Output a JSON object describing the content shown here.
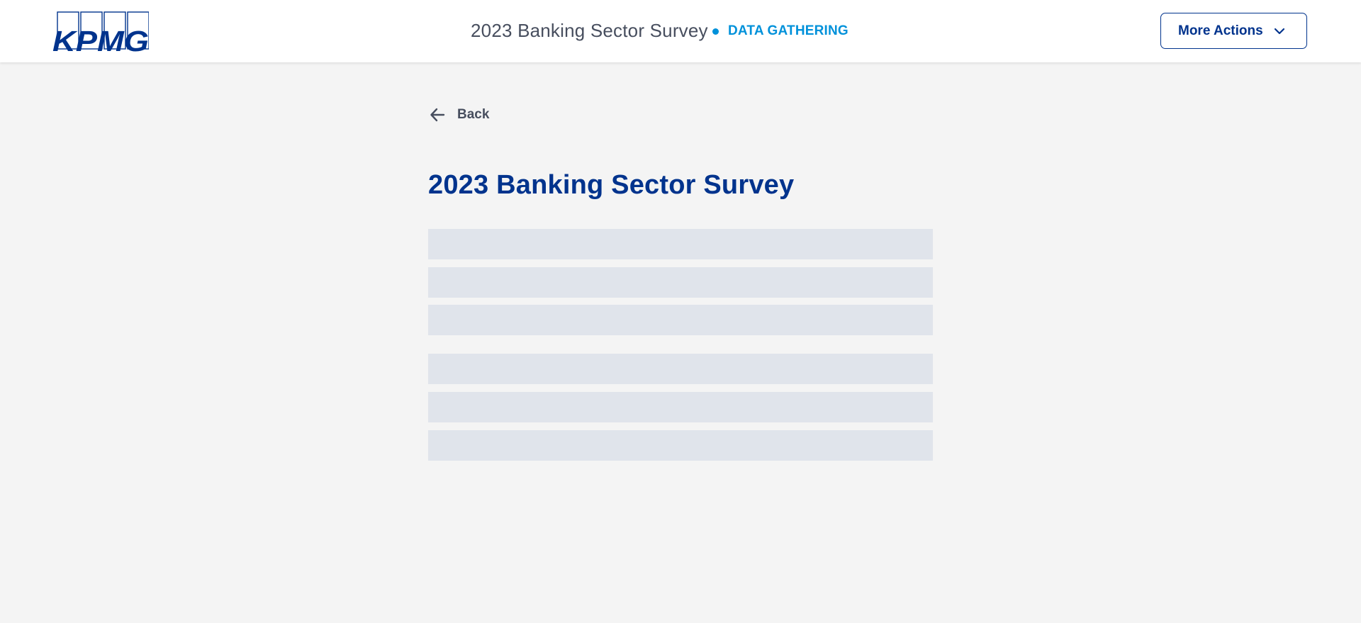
{
  "header": {
    "logo_text": "KPMG",
    "survey_title": "2023 Banking Sector Survey",
    "status": "DATA GATHERING",
    "more_actions_label": "More Actions"
  },
  "nav": {
    "back_label": "Back"
  },
  "main": {
    "title": "2023 Banking Sector Survey",
    "loading_placeholders": 6
  },
  "colors": {
    "brand_blue": "#00338d",
    "status_blue": "#0091da",
    "background": "#f4f4f4",
    "skeleton": "#e0e4eb"
  },
  "icons": {
    "back": "arrow-left-icon",
    "dropdown": "chevron-down-icon"
  }
}
